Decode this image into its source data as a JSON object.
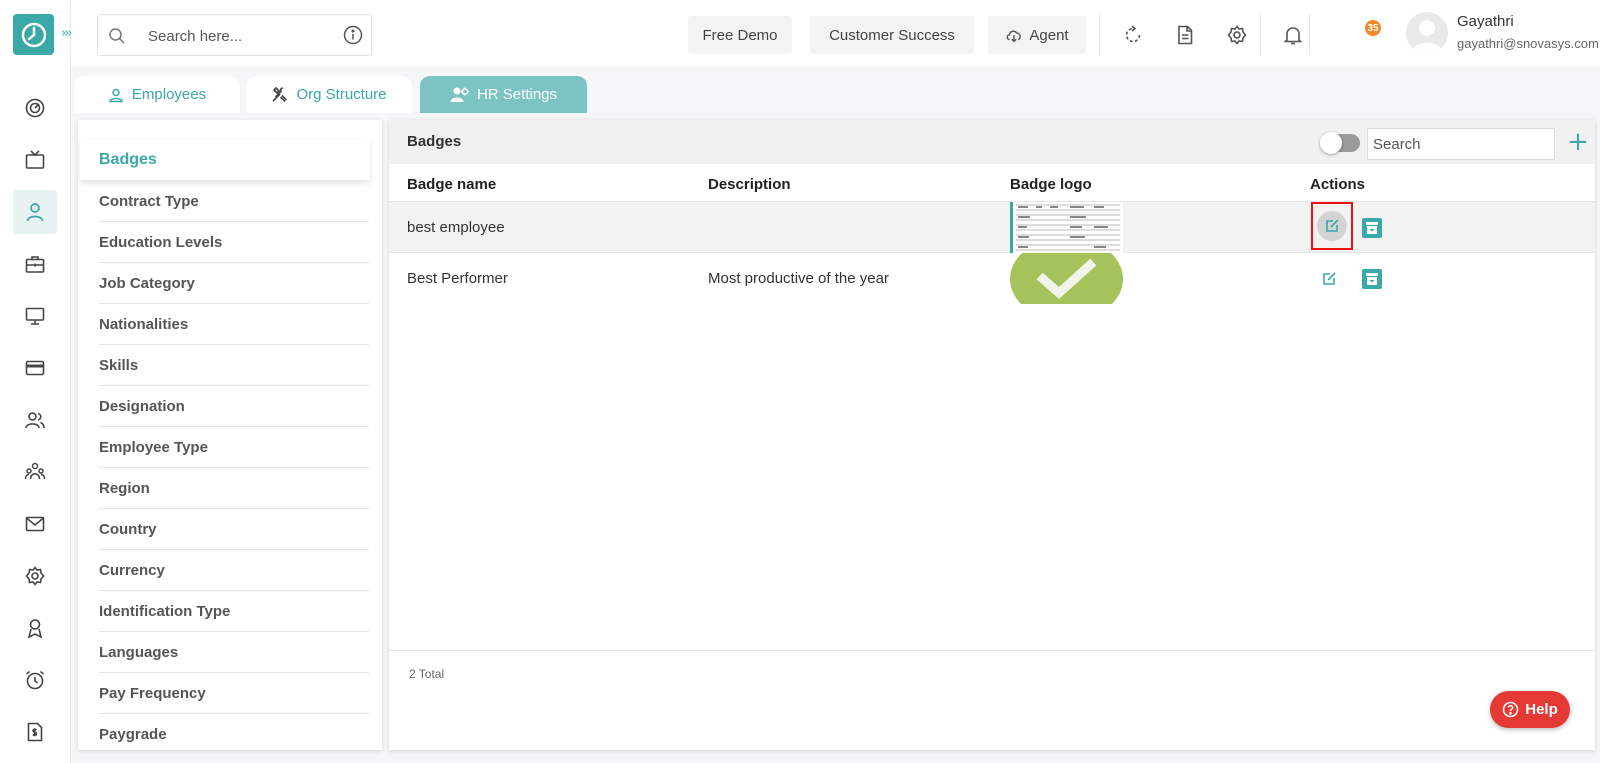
{
  "sidebar": {
    "icons": [
      "dashboard-icon",
      "tv-icon",
      "employees-icon",
      "briefcase-icon",
      "monitor-icon",
      "card-icon",
      "users-icon",
      "org-icon",
      "mail-icon",
      "settings-icon",
      "award-icon",
      "alarm-icon",
      "invoice-icon"
    ],
    "active_index": 2
  },
  "header": {
    "search_placeholder": "Search here...",
    "free_demo": "Free Demo",
    "customer_success": "Customer Success",
    "agent": "Agent",
    "notification_count": "35",
    "user_name": "Gayathri",
    "user_email": "gayathri@snovasys.com"
  },
  "tabs": [
    {
      "label": "Employees",
      "icon": "user-icon"
    },
    {
      "label": "Org Structure",
      "icon": "tools-icon"
    },
    {
      "label": "HR Settings",
      "icon": "user-settings-icon"
    }
  ],
  "settings_list": {
    "active": "Badges",
    "items": [
      "Contract Type",
      "Education Levels",
      "Job Category",
      "Nationalities",
      "Skills",
      "Designation",
      "Employee Type",
      "Region",
      "Country",
      "Currency",
      "Identification Type",
      "Languages",
      "Pay Frequency",
      "Paygrade"
    ]
  },
  "badges_panel": {
    "title": "Badges",
    "search_placeholder": "Search",
    "columns": [
      "Badge name",
      "Description",
      "Badge logo",
      "Actions"
    ],
    "rows": [
      {
        "name": "best employee",
        "description": "",
        "logo": "spreadsheet-thumbnail"
      },
      {
        "name": "Best Performer",
        "description": "Most productive of the year",
        "logo": "green-checkmark"
      }
    ],
    "total": "2 Total"
  },
  "help_label": "Help",
  "colors": {
    "accent": "#3aa8a6",
    "tab_active": "#7cc3c3",
    "help": "#e53935",
    "check_green": "#a5c25b"
  }
}
